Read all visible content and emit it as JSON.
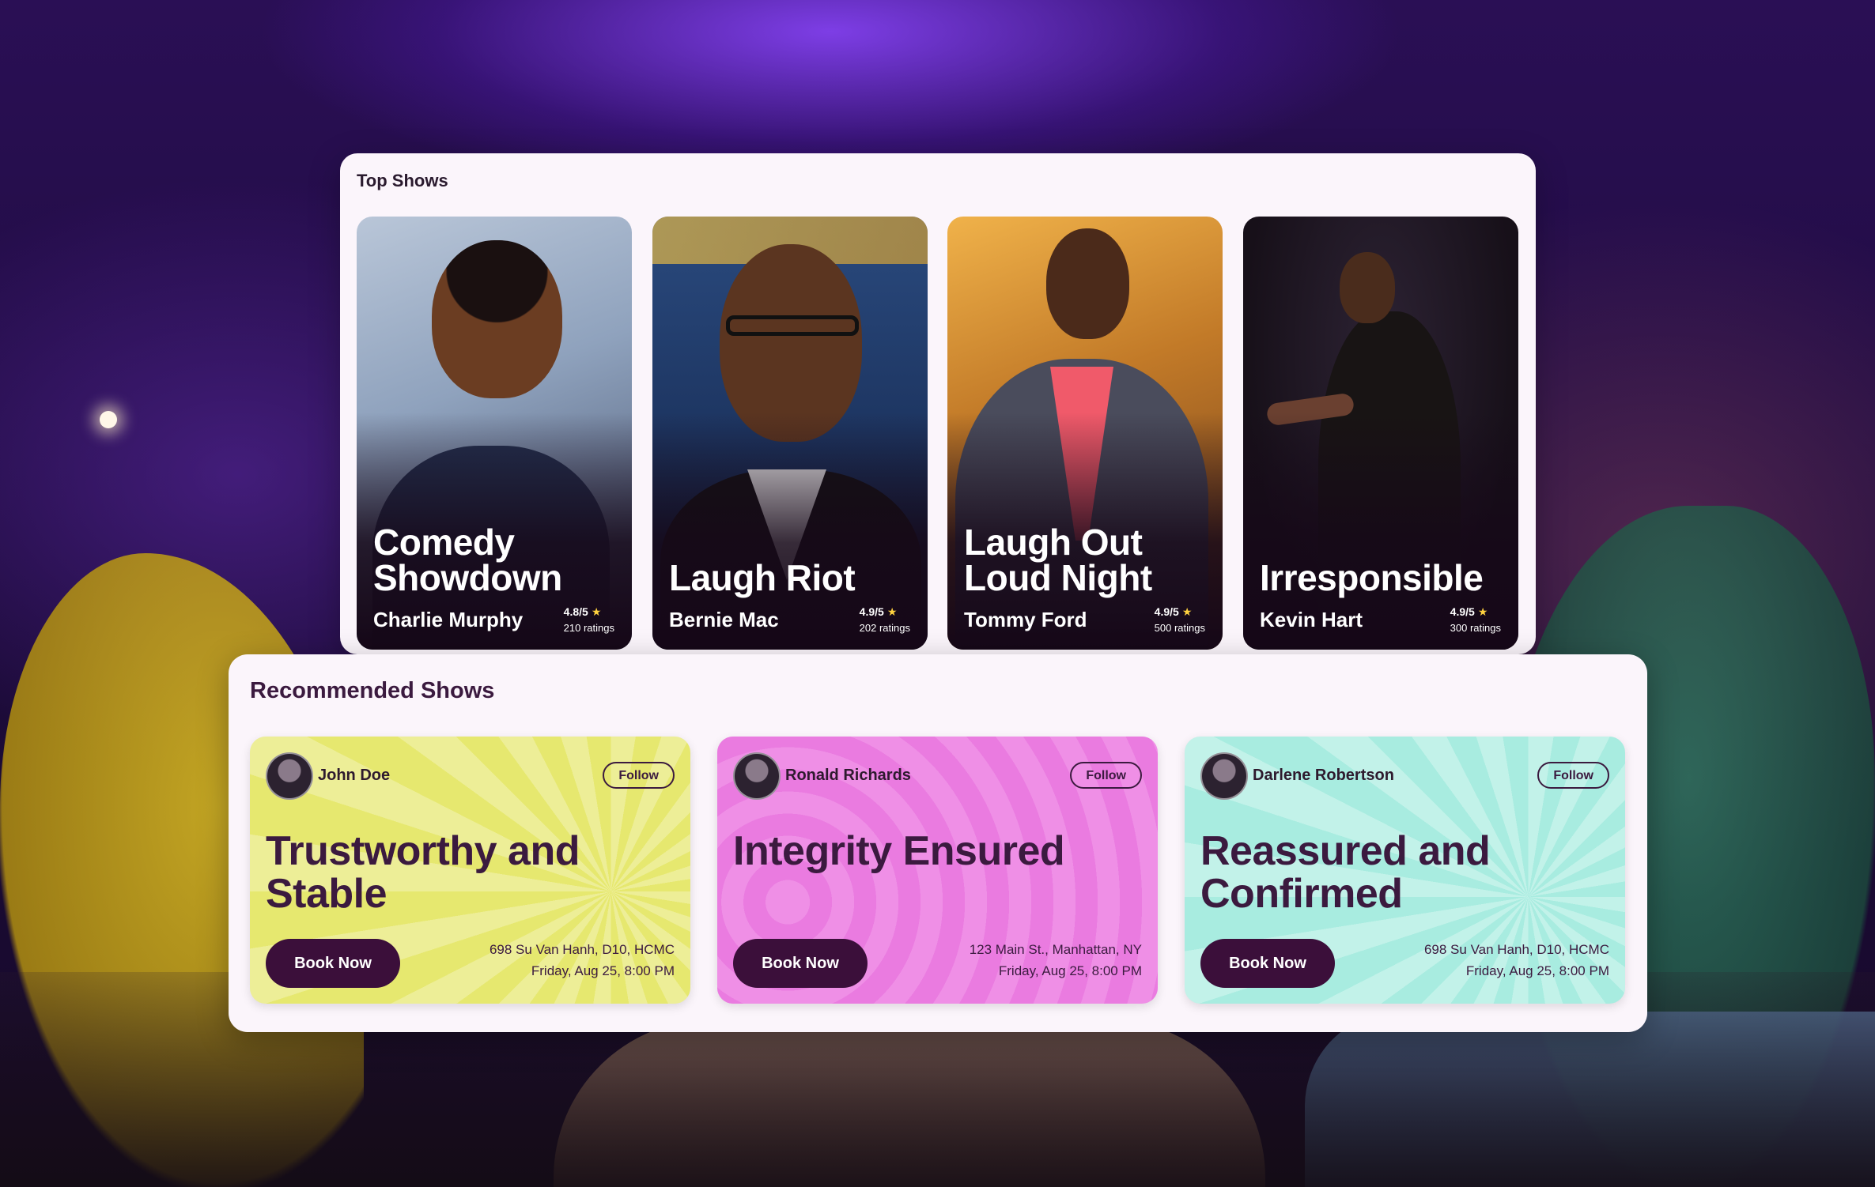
{
  "top_shows": {
    "title": "Top Shows",
    "cards": [
      {
        "title_line1": "Comedy",
        "title_line2": "Showdown",
        "performer": "Charlie Murphy",
        "score": "4.8/5",
        "ratings": "210 ratings"
      },
      {
        "title_line1": "",
        "title_line2": "Laugh Riot",
        "performer": "Bernie Mac",
        "score": "4.9/5",
        "ratings": "202 ratings"
      },
      {
        "title_line1": "Laugh Out",
        "title_line2": "Loud Night",
        "performer": "Tommy Ford",
        "score": "4.9/5",
        "ratings": "500 ratings"
      },
      {
        "title_line1": "",
        "title_line2": "Irresponsible",
        "performer": "Kevin Hart",
        "score": "4.9/5",
        "ratings": "300 ratings"
      }
    ]
  },
  "recommended": {
    "title": "Recommended Shows",
    "cards": [
      {
        "host": "John Doe",
        "follow": "Follow",
        "title_line1": "Trustworthy and",
        "title_line2": "Stable",
        "cta": "Book Now",
        "address": "698 Su Van Hanh, D10, HCMC",
        "datetime": "Friday, Aug 25, 8:00 PM",
        "color": "#e6e86f"
      },
      {
        "host": "Ronald Richards",
        "follow": "Follow",
        "title_line1": "Integrity Ensured",
        "title_line2": "",
        "cta": "Book Now",
        "address": "123 Main St., Manhattan, NY",
        "datetime": "Friday, Aug 25, 8:00 PM",
        "color": "#ef8fe6"
      },
      {
        "host": "Darlene Robertson",
        "follow": "Follow",
        "title_line1": "Reassured and",
        "title_line2": "Confirmed",
        "cta": "Book Now",
        "address": "698 Su Van Hanh, D10, HCMC",
        "datetime": "Friday, Aug 25, 8:00 PM",
        "color": "#a8ece0"
      }
    ]
  },
  "icons": {
    "star": "star-icon"
  }
}
